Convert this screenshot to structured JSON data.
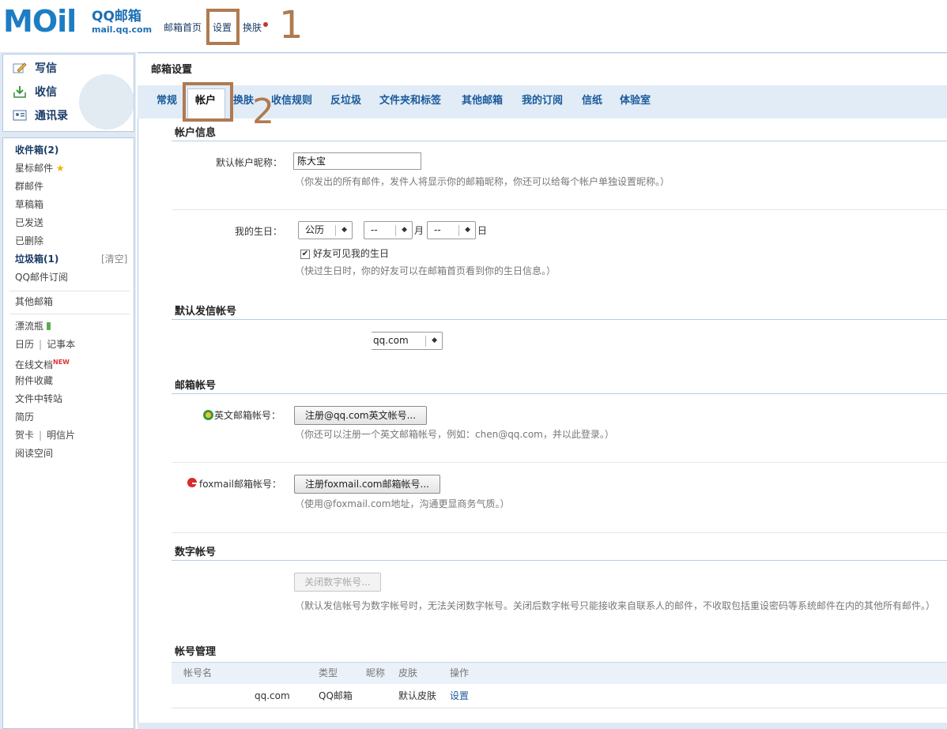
{
  "header": {
    "logo_text": "MOil",
    "brand": "QQ邮箱",
    "brand_url": "mail.qq.com",
    "nav": [
      "邮箱首页",
      "设置",
      "换肤"
    ],
    "annotation_1": "1"
  },
  "sidebar": {
    "quick": [
      "写信",
      "收信",
      "通讯录"
    ],
    "folders": {
      "inbox": "收件箱(2)",
      "starred": "星标邮件",
      "group": "群邮件",
      "drafts": "草稿箱",
      "sent": "已发送",
      "deleted": "已删除",
      "spam": "垃圾箱(1)",
      "spam_clear": "[清空]",
      "subscription": "QQ邮件订阅",
      "other": "其他邮箱",
      "bottle": "漂流瓶",
      "calendar": "日历",
      "notebook": "记事本",
      "docs": "在线文档",
      "docs_badge": "NEW",
      "attachments": "附件收藏",
      "transfer": "文件中转站",
      "resume": "简历",
      "greeting": "贺卡",
      "postcard": "明信片",
      "reading": "阅读空间"
    }
  },
  "main": {
    "title": "邮箱设置",
    "tabs": [
      "常规",
      "帐户",
      "换肤",
      "收信规则",
      "反垃圾",
      "文件夹和标签",
      "其他邮箱",
      "我的订阅",
      "信纸",
      "体验室"
    ],
    "annotation_2": "2",
    "account_info": {
      "title": "帐户信息",
      "nickname_label": "默认帐户昵称：",
      "nickname_value": "陈大宝",
      "nickname_hint": "（你发出的所有邮件，发件人将显示你的邮箱昵称，你还可以给每个帐户单独设置昵称。）",
      "birthday_label": "我的生日：",
      "calendar_type": "公历",
      "month_value": "--",
      "month_unit": "月",
      "day_value": "--",
      "day_unit": "日",
      "birthday_visible_label": "好友可见我的生日",
      "birthday_hint": "（快过生日时，你的好友可以在邮箱首页看到你的生日信息。）"
    },
    "default_sender": {
      "title": "默认发信帐号",
      "value": "qq.com"
    },
    "mail_accounts": {
      "title": "邮箱帐号",
      "english_label": "英文邮箱帐号：",
      "english_button": "注册@qq.com英文帐号...",
      "english_hint": "（你还可以注册一个英文邮箱帐号，例如：chen@qq.com，并以此登录。）",
      "foxmail_label": "foxmail邮箱帐号：",
      "foxmail_button": "注册foxmail.com邮箱帐号...",
      "foxmail_hint": "（使用@foxmail.com地址，沟通更显商务气质。）"
    },
    "numeric_account": {
      "title": "数字帐号",
      "button": "关闭数字帐号...",
      "hint": "（默认发信帐号为数字帐号时，无法关闭数字帐号。关闭后数字帐号只能接收来自联系人的邮件，不收取包括重设密码等系统邮件在内的其他所有邮件。）"
    },
    "account_management": {
      "title": "帐号管理",
      "columns": [
        "帐号名",
        "类型",
        "昵称",
        "皮肤",
        "操作"
      ],
      "rows": [
        {
          "name": "qq.com",
          "type": "QQ邮箱",
          "nickname": "",
          "skin": "默认皮肤",
          "action": "设置"
        }
      ]
    }
  }
}
